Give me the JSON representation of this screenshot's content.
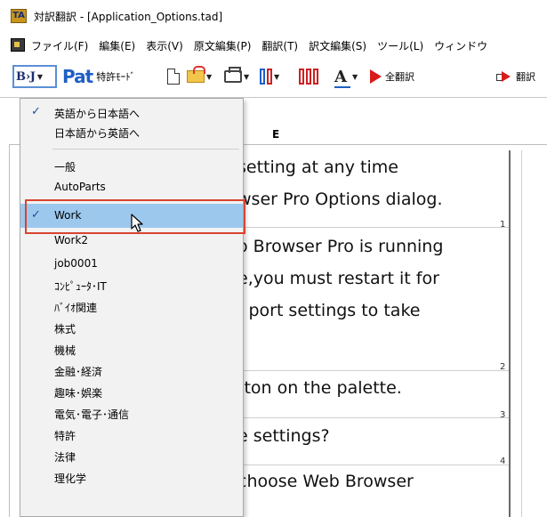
{
  "window": {
    "app_icon_text": "TA",
    "title": "対訳翻訳 - [Application_Options.tad]"
  },
  "menubar": {
    "items": [
      "ファイル(F)",
      "編集(E)",
      "表示(V)",
      "原文編集(P)",
      "翻訳(T)",
      "訳文編集(S)",
      "ツール(L)",
      "ウィンドウ"
    ]
  },
  "toolbar": {
    "bj_label": "B›J",
    "pat_label": "Pat",
    "pat_mode_label": "特許ﾓｰﾄﾞ",
    "font_icon_label": "A",
    "translate_all_label": "全翻訳",
    "translate_label": "翻訳"
  },
  "document": {
    "column_header": "E",
    "lines": [
      "setting at any time",
      "wser Pro Options dialog.",
      "o Browser Pro is running",
      "e,you must restart it for",
      "/ port settings to take",
      "tton on the palette.",
      "e settings?",
      "choose Web Browser"
    ],
    "row_numbers": [
      "1",
      "2",
      "3",
      "4"
    ]
  },
  "dropdown": {
    "items": [
      {
        "label": "英語から日本語へ",
        "checked": true
      },
      {
        "label": "日本語から英語へ",
        "checked": false
      },
      {
        "label": "一般",
        "checked": false
      },
      {
        "label": "AutoParts",
        "checked": false
      },
      {
        "label": "Work",
        "checked": true
      },
      {
        "label": "Work2",
        "checked": false
      },
      {
        "label": "job0001",
        "checked": false
      },
      {
        "label": "ｺﾝﾋﾟｭｰﾀ･IT",
        "checked": false
      },
      {
        "label": "ﾊﾞｲｵ関連",
        "checked": false
      },
      {
        "label": "株式",
        "checked": false
      },
      {
        "label": "機械",
        "checked": false
      },
      {
        "label": "金融･経済",
        "checked": false
      },
      {
        "label": "趣味･娯楽",
        "checked": false
      },
      {
        "label": "電気･電子･通信",
        "checked": false
      },
      {
        "label": "特許",
        "checked": false
      },
      {
        "label": "法律",
        "checked": false
      },
      {
        "label": "理化学",
        "checked": false
      }
    ],
    "check_glyph": "✓"
  }
}
